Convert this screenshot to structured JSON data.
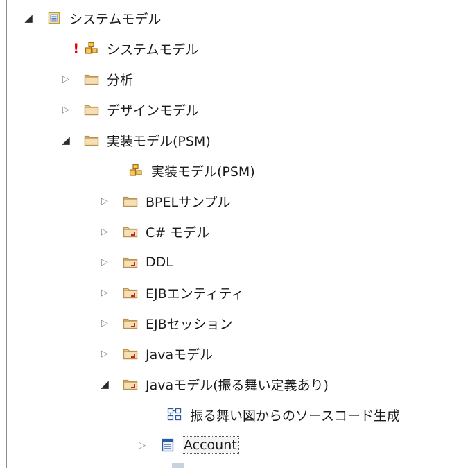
{
  "tree": {
    "root": {
      "label": "システムモデル",
      "icon": "model-root-icon"
    },
    "items": [
      {
        "label": "システムモデル",
        "icon": "package-diagram-icon",
        "warning": "!"
      },
      {
        "label": "分析",
        "icon": "folder-icon"
      },
      {
        "label": "デザインモデル",
        "icon": "folder-icon"
      },
      {
        "label": "実装モデル(PSM)",
        "icon": "folder-icon"
      },
      {
        "label": "実装モデル(PSM)",
        "icon": "package-diagram-icon"
      },
      {
        "label": "BPELサンプル",
        "icon": "folder-icon"
      },
      {
        "label": "C# モデル",
        "icon": "code-folder-icon"
      },
      {
        "label": "DDL",
        "icon": "code-folder-icon"
      },
      {
        "label": "EJBエンティティ",
        "icon": "code-folder-icon"
      },
      {
        "label": "EJBセッション",
        "icon": "code-folder-icon"
      },
      {
        "label": "Javaモデル",
        "icon": "code-folder-icon"
      },
      {
        "label": "Javaモデル(振る舞い定義あり)",
        "icon": "code-folder-icon"
      },
      {
        "label": "振る舞い図からのソースコード生成",
        "icon": "class-diagram-icon"
      },
      {
        "label": "Account",
        "icon": "class-icon",
        "selected": true
      }
    ]
  },
  "colors": {
    "folder_fill": "#f3d7a6",
    "folder_stroke": "#b8924f",
    "code_mark": "#c0281e",
    "package_icon": "#d9a030",
    "warning": "#e00000",
    "tree_line": "#8c8c8c"
  }
}
